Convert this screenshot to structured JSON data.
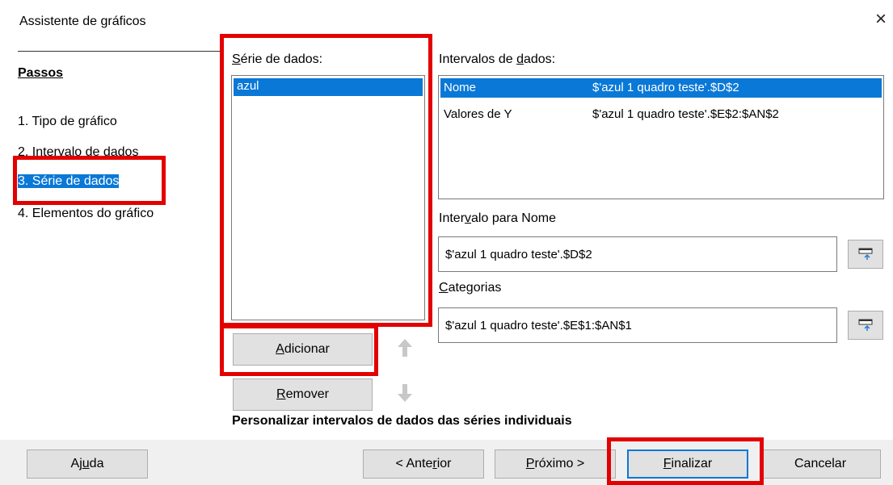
{
  "window": {
    "title": "Assistente de gráficos",
    "close_glyph": "×"
  },
  "steps": {
    "title": "Passos",
    "items": [
      {
        "label": "1. Tipo de gráfico"
      },
      {
        "label": "2. Intervalo de dados"
      },
      {
        "label": "3. Série de dados",
        "selected": true
      },
      {
        "label": "4. Elementos do gráfico"
      }
    ]
  },
  "series": {
    "label_underlined": "S",
    "label_rest": "érie de dados:",
    "items": [
      {
        "label": "azul",
        "selected": true
      }
    ],
    "add_prefix": "",
    "add_u": "A",
    "add_rest": "dicionar",
    "remove_u": "R",
    "remove_rest": "emover",
    "up_icon": "arrow-up-icon",
    "down_icon": "arrow-down-icon"
  },
  "ranges": {
    "label_pre": "Intervalos de ",
    "label_u": "d",
    "label_post": "ados:",
    "rows": [
      {
        "role": "Nome",
        "range": "$'azul 1 quadro teste'.$D$2",
        "selected": true
      },
      {
        "role": "Valores de Y",
        "range": "$'azul 1 quadro teste'.$E$2:$AN$2"
      }
    ]
  },
  "name_range": {
    "label_pre": "Inter",
    "label_u": "v",
    "label_post": "alo para Nome",
    "value": "$'azul 1 quadro teste'.$D$2"
  },
  "categories": {
    "label_u": "C",
    "label_post": "ategorias",
    "value": "$'azul 1 quadro teste'.$E$1:$AN$1"
  },
  "hint": "Personalizar intervalos de dados das séries individuais",
  "footer": {
    "help_pre": "Aj",
    "help_u": "u",
    "help_post": "da",
    "back_pre": "< Ante",
    "back_u": "r",
    "back_post": "ior",
    "next_u": "P",
    "next_post": "róximo >",
    "finish_u": "F",
    "finish_post": "inalizar",
    "cancel": "Cancelar"
  },
  "colors": {
    "selection": "#0a78d7",
    "highlight_box": "#e30000",
    "button_face": "#e1e1e1"
  }
}
